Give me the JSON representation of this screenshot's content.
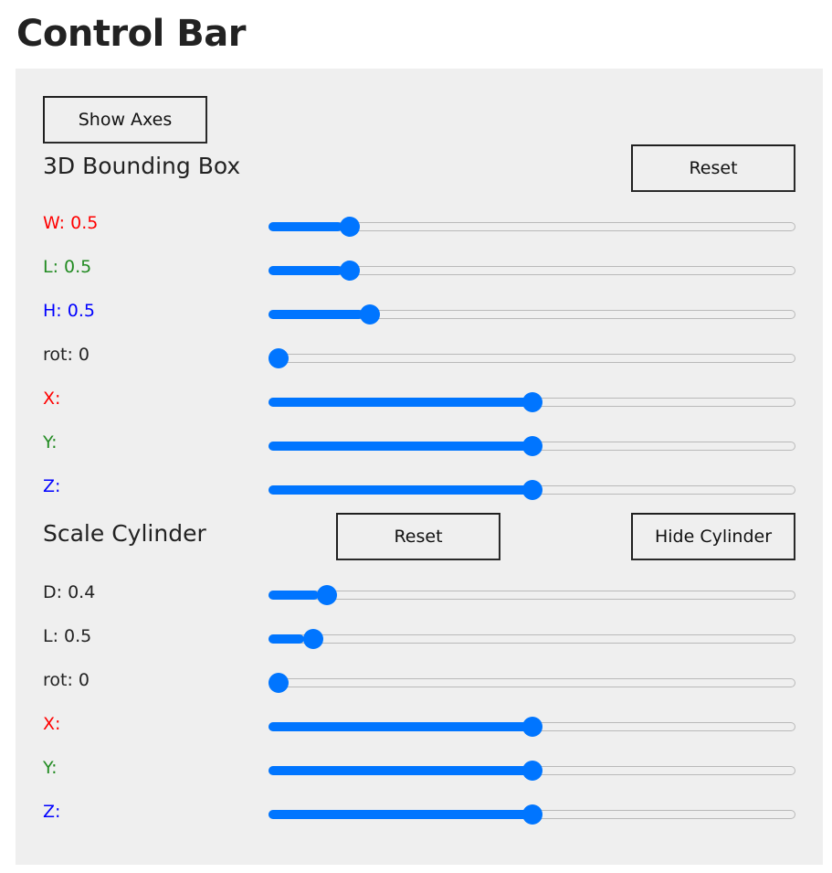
{
  "page_title": "Control Bar",
  "colors": {
    "red": "#ff0000",
    "green": "#228b22",
    "blue": "#0000ff",
    "dark": "#222222",
    "accent": "#0075ff"
  },
  "buttons": {
    "show_axes": "Show Axes",
    "bbox_reset": "Reset",
    "cyl_reset": "Reset",
    "hide_cylinder": "Hide Cylinder"
  },
  "bbox": {
    "title": "3D Bounding Box",
    "rows": [
      {
        "label": "W: 0.5",
        "value": 0.14,
        "color": "#ff0000"
      },
      {
        "label": "L: 0.5",
        "value": 0.14,
        "color": "#228b22"
      },
      {
        "label": "H: 0.5",
        "value": 0.18,
        "color": "#0000ff"
      },
      {
        "label": "rot: 0",
        "value": 0.0,
        "color": "#222222"
      },
      {
        "label": "X:",
        "value": 0.5,
        "color": "#ff0000"
      },
      {
        "label": "Y:",
        "value": 0.5,
        "color": "#228b22"
      },
      {
        "label": "Z:",
        "value": 0.5,
        "color": "#0000ff"
      }
    ]
  },
  "cylinder": {
    "title": "Scale Cylinder",
    "rows": [
      {
        "label": "D: 0.4",
        "value": 0.095,
        "color": "#222222"
      },
      {
        "label": "L: 0.5",
        "value": 0.068,
        "color": "#222222"
      },
      {
        "label": "rot: 0",
        "value": 0.0,
        "color": "#222222"
      },
      {
        "label": "X:",
        "value": 0.5,
        "color": "#ff0000"
      },
      {
        "label": "Y:",
        "value": 0.5,
        "color": "#228b22"
      },
      {
        "label": "Z:",
        "value": 0.5,
        "color": "#0000ff"
      }
    ]
  }
}
